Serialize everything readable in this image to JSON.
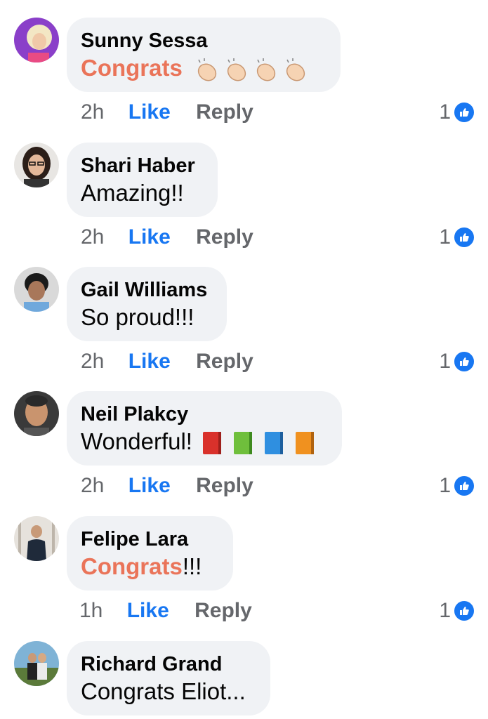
{
  "comments": [
    {
      "author": "Sunny Sessa",
      "text": "Congrats",
      "text_suffix": "",
      "emoji": "clapping-hands x4",
      "time": "2h",
      "like": "Like",
      "reply": "Reply",
      "reactions": "1"
    },
    {
      "author": "Shari Haber",
      "text": "Amazing!!",
      "time": "2h",
      "like": "Like",
      "reply": "Reply",
      "reactions": "1"
    },
    {
      "author": "Gail Williams",
      "text": "So proud!!!",
      "time": "2h",
      "like": "Like",
      "reply": "Reply",
      "reactions": "1"
    },
    {
      "author": "Neil Plakcy",
      "text": "Wonderful!",
      "emoji": "books x4",
      "time": "2h",
      "like": "Like",
      "reply": "Reply",
      "reactions": "1"
    },
    {
      "author": "Felipe Lara",
      "text": "Congrats",
      "text_suffix": "!!!",
      "time": "1h",
      "like": "Like",
      "reply": "Reply",
      "reactions": "1"
    },
    {
      "author": "Richard Grand",
      "text": "Congrats Eliot..."
    }
  ],
  "colors": {
    "bubble": "#f0f2f5",
    "like": "#1877f2",
    "highlight": "#ea7459",
    "meta": "#65676b"
  }
}
